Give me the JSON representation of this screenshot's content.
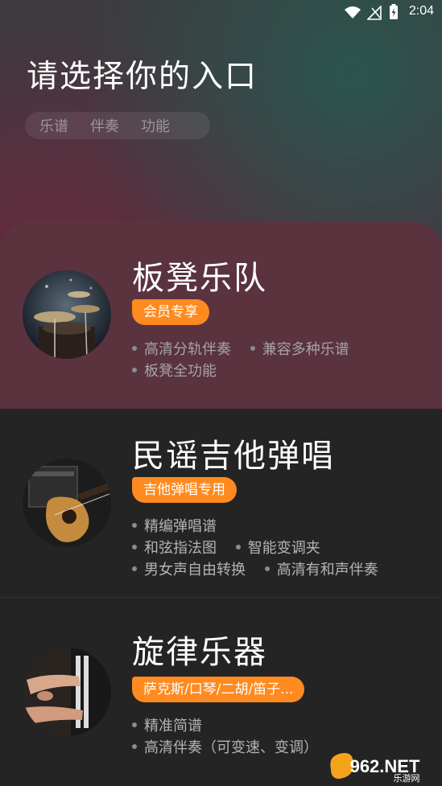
{
  "status_bar": {
    "time": "2:04"
  },
  "header": {
    "title": "请选择你的入口",
    "tabs": [
      "乐谱",
      "伴奏",
      "功能"
    ]
  },
  "cards": [
    {
      "name": "板凳乐队",
      "badge": "会员专享",
      "features": [
        [
          "高清分轨伴奏",
          "兼容多种乐谱"
        ],
        [
          "板凳全功能"
        ]
      ]
    },
    {
      "name": "民谣吉他弹唱",
      "badge": "吉他弹唱专用",
      "features": [
        [
          "精编弹唱谱"
        ],
        [
          "和弦指法图",
          "智能变调夹"
        ],
        [
          "男女声自由转换",
          "高清有和声伴奏"
        ]
      ]
    },
    {
      "name": "旋律乐器",
      "badge": "萨克斯/口琴/二胡/笛子...",
      "features": [
        [
          "精准简谱"
        ],
        [
          "高清伴奏（可变速、变调）"
        ]
      ]
    }
  ],
  "watermark": {
    "text_main": "962.NET",
    "text_sub": "乐游网"
  },
  "colors": {
    "accent": "#ff8a1f",
    "card1_bg": "#5a333f",
    "card_bg": "#242425"
  }
}
